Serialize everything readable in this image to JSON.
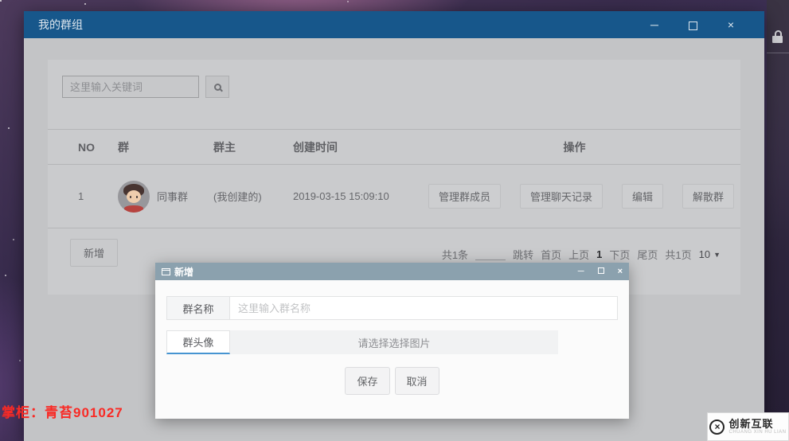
{
  "glyphs": {
    "minimize": "─",
    "close": "×",
    "caret": "▼",
    "times": "×"
  },
  "desktop": {
    "owner_text": "掌柜：青苔901027",
    "watermark": {
      "brand": "创新互联",
      "sub": "CHUANG XIN HU LIAN"
    }
  },
  "window": {
    "title": "我的群组",
    "search": {
      "placeholder": "这里输入关键词"
    },
    "table": {
      "headers": [
        "NO",
        "群",
        "群主",
        "创建时间",
        "操作"
      ],
      "rows": [
        {
          "no": "1",
          "group": "同事群",
          "owner": "(我创建的)",
          "created": "2019-03-15 15:09:10",
          "actions": [
            "管理群成员",
            "管理聊天记录",
            "编辑",
            "解散群"
          ]
        }
      ]
    },
    "add_label": "新增",
    "pagination": {
      "total": "共1条",
      "jump": "跳转",
      "first": "首页",
      "prev": "上页",
      "current": "1",
      "next": "下页",
      "last": "尾页",
      "pages": "共1页",
      "page_size": "10"
    }
  },
  "modal": {
    "title": "新增",
    "fields": [
      {
        "label": "群名称",
        "placeholder": "这里输入群名称"
      },
      {
        "label": "群头像",
        "value": "请选择选择图片"
      }
    ],
    "save": "保存",
    "cancel": "取消"
  }
}
